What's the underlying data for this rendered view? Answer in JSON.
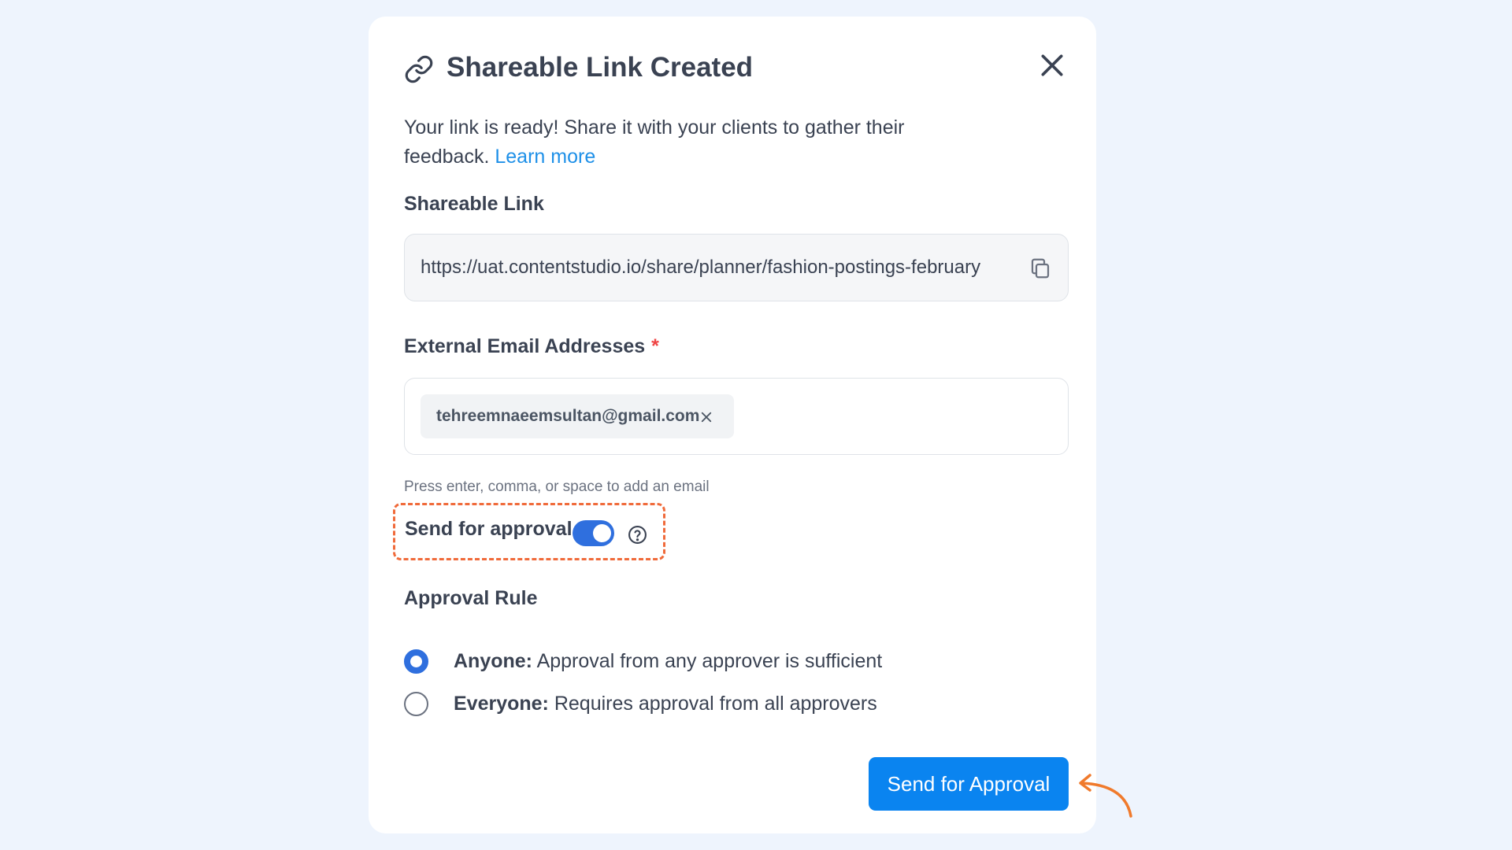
{
  "modal": {
    "title": "Shareable Link Created",
    "description": "Your link is ready! Share it with your clients to gather their feedback.",
    "learn_more": "Learn more"
  },
  "shareable_link": {
    "label": "Shareable Link",
    "value": "https://uat.contentstudio.io/share/planner/fashion-postings-february"
  },
  "emails": {
    "label": "External Email Addresses",
    "required_mark": "*",
    "chips": [
      "tehreemnaeemsultan@gmail.com"
    ],
    "hint": "Press enter, comma, or space to add an email"
  },
  "send_for_approval": {
    "label": "Send for approval",
    "enabled": true
  },
  "approval_rule": {
    "label": "Approval Rule",
    "options": [
      {
        "name": "Anyone:",
        "description": "Approval from any approver is sufficient",
        "selected": true
      },
      {
        "name": "Everyone:",
        "description": "Requires approval from all approvers",
        "selected": false
      }
    ]
  },
  "actions": {
    "submit_label": "Send for Approval"
  },
  "colors": {
    "primary": "#0a84f0",
    "toggle": "#2f6fde",
    "link": "#1e90e8",
    "highlight": "#f06a3a",
    "background": "#eef4fd"
  },
  "icons": [
    "link-icon",
    "close-icon",
    "copy-icon",
    "remove-chip-icon",
    "help-icon",
    "mouse-cursor-icon",
    "curved-arrow-icon"
  ]
}
